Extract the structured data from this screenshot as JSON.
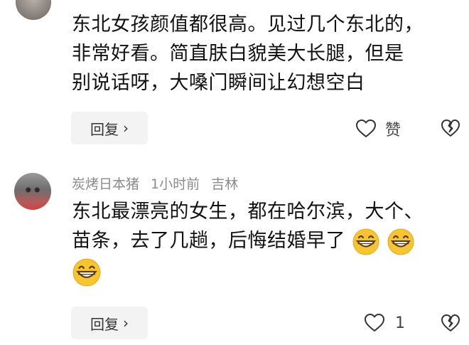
{
  "comments": [
    {
      "text_line1": "东北女孩颜值都很高。见过几个东北的，",
      "text_line2": "非常好看。简直肤白貌美大长腿，但是",
      "text_line3": "别说话呀，大嗓门瞬间让幻想空白",
      "reply_label": "回复",
      "like_label": "赞"
    },
    {
      "username": "炭烤日本猪",
      "time": "1小时前",
      "location": "吉林",
      "text_line1": "东北最漂亮的女生，都在哈尔滨，大个、",
      "text_line2": "苗条，去了几趟，后悔结婚早了",
      "reply_label": "回复",
      "like_count": "1"
    }
  ],
  "icons": {
    "like": "heart-outline-icon",
    "dislike": "broken-heart-icon",
    "emoji": "grinning-face-emoji",
    "reply_arrow": "chevron-right-icon"
  },
  "colors": {
    "emoji_yellow": "#f7c531",
    "reply_bg": "#f3f3f3",
    "meta_gray": "#8a8a8a"
  }
}
